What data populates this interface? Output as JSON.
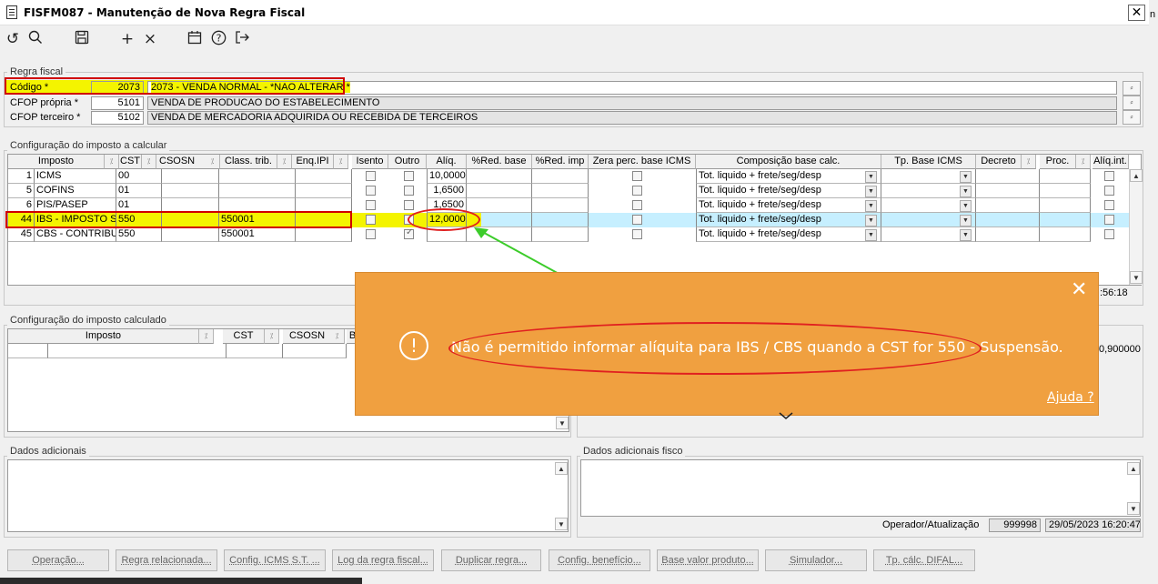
{
  "window": {
    "title": "FISFM087 - Manutenção de Nova Regra Fiscal",
    "close": "✕"
  },
  "toolbar": {
    "icons": [
      "undo-icon",
      "search-icon",
      "save-icon",
      "add-icon",
      "delete-icon",
      "calendar-icon",
      "help-icon",
      "exit-icon"
    ]
  },
  "regra": {
    "legend": "Regra fiscal",
    "codigo_label": "Código *",
    "codigo_value": "2073",
    "codigo_desc": "2073 - VENDA NORMAL - *NAO ALTERAR *",
    "cfop_propria_label": "CFOP própria *",
    "cfop_propria_value": "5101",
    "cfop_propria_desc": "VENDA DE PRODUCAO DO ESTABELECIMENTO",
    "cfop_terceiro_label": "CFOP terceiro *",
    "cfop_terceiro_value": "5102",
    "cfop_terceiro_desc": "VENDA DE MERCADORIA ADQUIRIDA OU RECEBIDA DE TERCEIROS",
    "edit_glyph": "⸗"
  },
  "config": {
    "legend": "Configuração do imposto a calcular",
    "headers": {
      "imposto": "Imposto",
      "cst": "CST",
      "csosn": "CSOSN",
      "class": "Class. trib.",
      "enq": "Enq.IPI",
      "isento": "Isento",
      "outro": "Outro",
      "aliq": "Alíq.",
      "redbase": "%Red. base",
      "redimp": "%Red. imp",
      "zera": "Zera perc. base ICMS",
      "comp": "Composição base calc.",
      "tpbase": "Tp. Base ICMS",
      "decreto": "Decreto",
      "proc": "Proc.",
      "aliqint": "Alíq.int."
    },
    "rows": [
      {
        "n": "1",
        "imposto": "ICMS",
        "cst": "00",
        "class": "",
        "aliq": "10,0000",
        "comp": "Tot. liquido + frete/seg/desp"
      },
      {
        "n": "5",
        "imposto": "COFINS",
        "cst": "01",
        "class": "",
        "aliq": "1,6500",
        "comp": "Tot. liquido + frete/seg/desp"
      },
      {
        "n": "6",
        "imposto": "PIS/PASEP",
        "cst": "01",
        "class": "",
        "aliq": "1,6500",
        "comp": "Tot. liquido + frete/seg/desp"
      },
      {
        "n": "44",
        "imposto": "IBS - IMPOSTO SO",
        "cst": "550",
        "class": "550001",
        "aliq": "12,0000",
        "comp": "Tot. liquido + frete/seg/desp"
      },
      {
        "n": "45",
        "imposto": "CBS - CONTRIBUIÇ",
        "cst": "550",
        "class": "550001",
        "aliq": "",
        "comp": "Tot. liquido + frete/seg/desp"
      }
    ],
    "time_partial": ":56:18"
  },
  "calculado": {
    "legend": "Configuração do imposto calculado",
    "headers": {
      "imposto": "Imposto",
      "cst": "CST",
      "csosn": "CSOSN",
      "b": "B"
    },
    "right_value": "0,900000"
  },
  "dados": {
    "legend": "Dados adicionais"
  },
  "dados_fisco": {
    "legend": "Dados adicionais fisco"
  },
  "operador": {
    "label": "Operador/Atualização",
    "user": "999998",
    "timestamp": "29/05/2023 16:20:47"
  },
  "buttons": [
    "Operação...",
    "Regra relacionada...",
    "Config. ICMS S.T. ...",
    "Log da regra fiscal...",
    "Duplicar regra...",
    "Config. benefício...",
    "Base valor produto...",
    "Simulador...",
    "Tp. cálc. DIFAL..."
  ],
  "toast": {
    "message": "Não é permitido informar alíquita para IBS / CBS quando a CST for 550 - Suspensão.",
    "help": "Ajuda ?",
    "close": "✕",
    "icon": "!"
  },
  "edge_text": "n"
}
